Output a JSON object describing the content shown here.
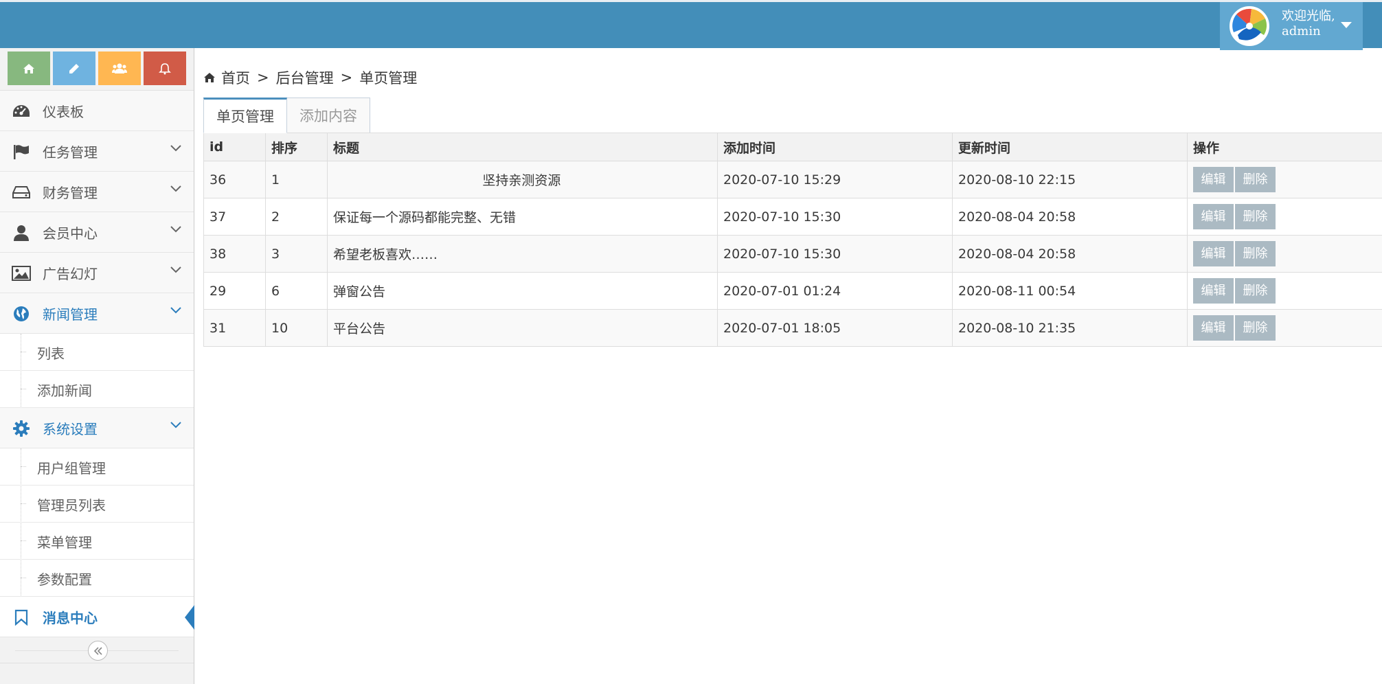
{
  "header": {
    "welcome": "欢迎光临,",
    "username": "admin"
  },
  "colors": {
    "navbar": "#438eb9",
    "shortcut_home": "#87b87f",
    "shortcut_edit": "#6fb3e0",
    "shortcut_users": "#ffb752",
    "shortcut_bell": "#d15b47",
    "accent": "#2b7dbc"
  },
  "sidebar": {
    "items": [
      {
        "label": "仪表板"
      },
      {
        "label": "任务管理"
      },
      {
        "label": "财务管理"
      },
      {
        "label": "会员中心"
      },
      {
        "label": "广告幻灯"
      },
      {
        "label": "新闻管理",
        "sub": [
          "列表",
          "添加新闻"
        ]
      },
      {
        "label": "系统设置",
        "sub": [
          "用户组管理",
          "管理员列表",
          "菜单管理",
          "参数配置"
        ]
      },
      {
        "label": "消息中心"
      }
    ]
  },
  "breadcrumb": [
    "首页",
    "后台管理",
    "单页管理"
  ],
  "tabs": [
    "单页管理",
    "添加内容"
  ],
  "table": {
    "headers": [
      "id",
      "排序",
      "标题",
      "添加时间",
      "更新时间",
      "操作"
    ],
    "rows": [
      {
        "id": "36",
        "sort": "1",
        "title": "                                    坚持亲测资源",
        "added": "2020-07-10 15:29",
        "updated": "2020-08-10 22:15"
      },
      {
        "id": "37",
        "sort": "2",
        "title": "保证每一个源码都能完整、无错",
        "added": "2020-07-10 15:30",
        "updated": "2020-08-04 20:58"
      },
      {
        "id": "38",
        "sort": "3",
        "title": "希望老板喜欢……",
        "added": "2020-07-10 15:30",
        "updated": "2020-08-04 20:58"
      },
      {
        "id": "29",
        "sort": "6",
        "title": "弹窗公告",
        "added": "2020-07-01 01:24",
        "updated": "2020-08-11 00:54"
      },
      {
        "id": "31",
        "sort": "10",
        "title": "平台公告",
        "added": "2020-07-01 18:05",
        "updated": "2020-08-10 21:35"
      }
    ],
    "edit_label": "编辑",
    "delete_label": "删除"
  }
}
